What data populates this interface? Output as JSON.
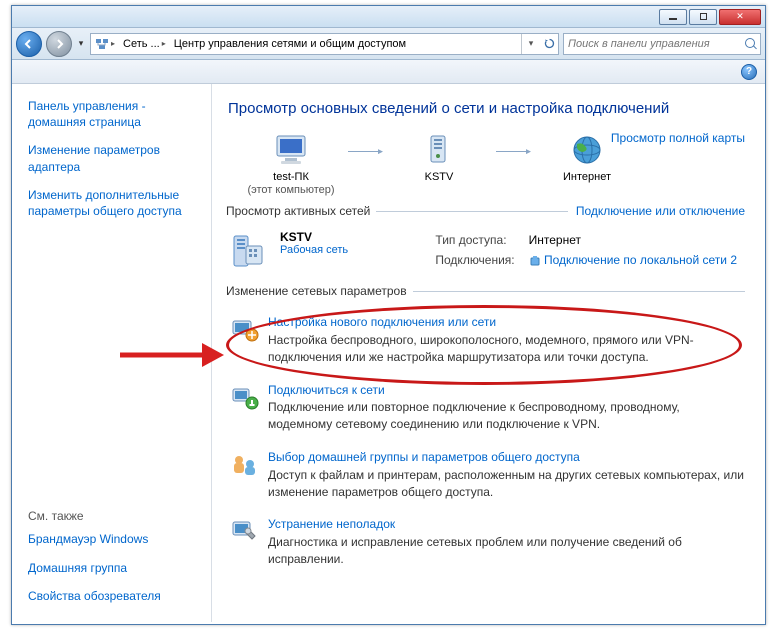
{
  "breadcrumb": {
    "item1": "Сеть ...",
    "item2": "Центр управления сетями и общим доступом"
  },
  "search": {
    "placeholder": "Поиск в панели управления"
  },
  "sidebar": {
    "links": [
      "Панель управления - домашняя страница",
      "Изменение параметров адаптера",
      "Изменить дополнительные параметры общего доступа"
    ],
    "see_also_hdr": "См. также",
    "see_also": [
      "Брандмауэр Windows",
      "Домашняя группа",
      "Свойства обозревателя"
    ]
  },
  "main": {
    "title": "Просмотр основных сведений о сети и настройка подключений",
    "map_link": "Просмотр полной карты",
    "map": {
      "node1": "test-ПК",
      "node1sub": "(этот компьютер)",
      "node2": "KSTV",
      "node3": "Интернет"
    },
    "active_hdr": "Просмотр активных сетей",
    "active_link": "Подключение или отключение",
    "network": {
      "name": "KSTV",
      "category": "Рабочая сеть",
      "access_lbl": "Тип доступа:",
      "access_val": "Интернет",
      "conn_lbl": "Подключения:",
      "conn_val": "Подключение по локальной сети 2"
    },
    "change_hdr": "Изменение сетевых параметров",
    "tasks": [
      {
        "title": "Настройка нового подключения или сети",
        "desc": "Настройка беспроводного, широкополосного, модемного, прямого или VPN-подключения или же настройка маршрутизатора или точки доступа."
      },
      {
        "title": "Подключиться к сети",
        "desc": "Подключение или повторное подключение к беспроводному, проводному, модемному сетевому соединению или подключение к VPN."
      },
      {
        "title": "Выбор домашней группы и параметров общего доступа",
        "desc": "Доступ к файлам и принтерам, расположенным на других сетевых компьютерах, или изменение параметров общего доступа."
      },
      {
        "title": "Устранение неполадок",
        "desc": "Диагностика и исправление сетевых проблем или получение сведений об исправлении."
      }
    ]
  }
}
